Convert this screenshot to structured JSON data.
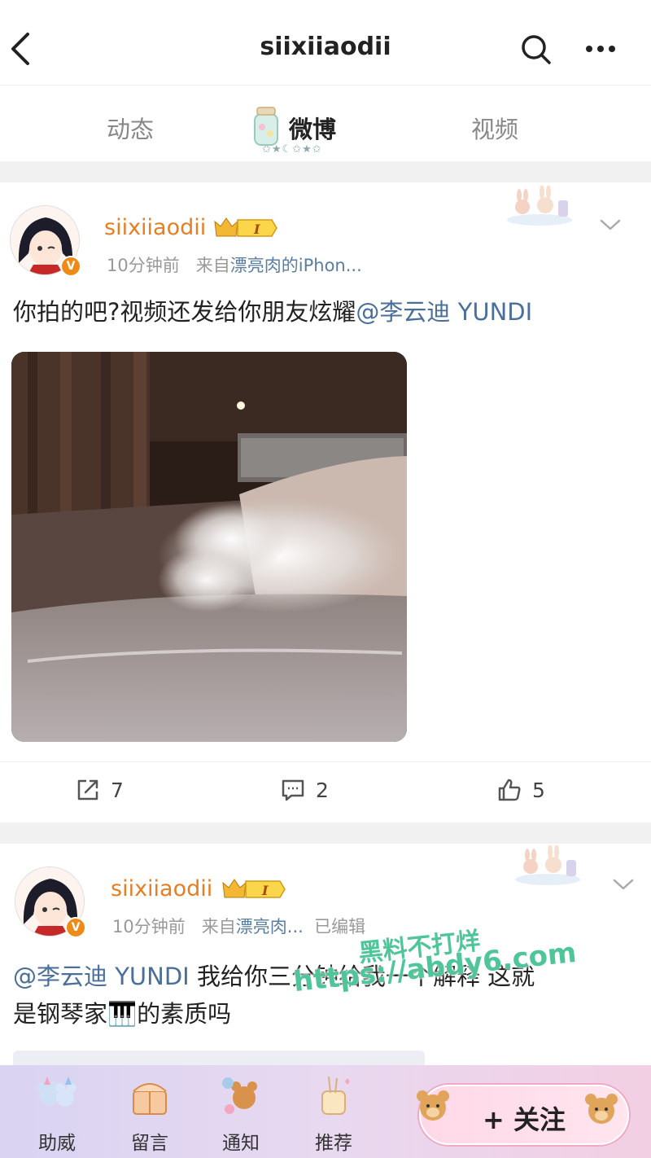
{
  "topbar": {
    "title": "siixiiaodii"
  },
  "tabs": [
    {
      "label": "动态"
    },
    {
      "label": "微博"
    },
    {
      "label": "视频"
    }
  ],
  "posts": [
    {
      "username": "siixiiaodii",
      "vip_level": "I",
      "time": "10分钟前",
      "source_prefix": "来自",
      "source": "漂亮肉的iPhon...",
      "text_before": "你拍的吧?视频还发给你朋友炫耀",
      "mention": "@李云迪 YUNDI",
      "actions": {
        "repost": "7",
        "comment": "2",
        "like": "5"
      }
    },
    {
      "username": "siixiiaodii",
      "vip_level": "I",
      "time": "10分钟前",
      "source_prefix": "来自",
      "source": "漂亮肉...",
      "edited": "已编辑",
      "mention": "@李云迪 YUNDI",
      "text_line1": " 我给你三分钟给我一个解释  这就",
      "text_line2": "是钢琴家🎹的素质吗"
    }
  ],
  "watermark": {
    "line1": "黑料不打烊",
    "line2": "https://abdy6.com"
  },
  "bottom_bar": {
    "items": [
      {
        "label": "助威"
      },
      {
        "label": "留言"
      },
      {
        "label": "通知"
      },
      {
        "label": "推荐"
      }
    ],
    "follow_label": "+ 关注"
  },
  "colors": {
    "accent_orange": "#e67e22",
    "link_blue": "#4a6f9a",
    "watermark_green": "#4fc59a"
  }
}
